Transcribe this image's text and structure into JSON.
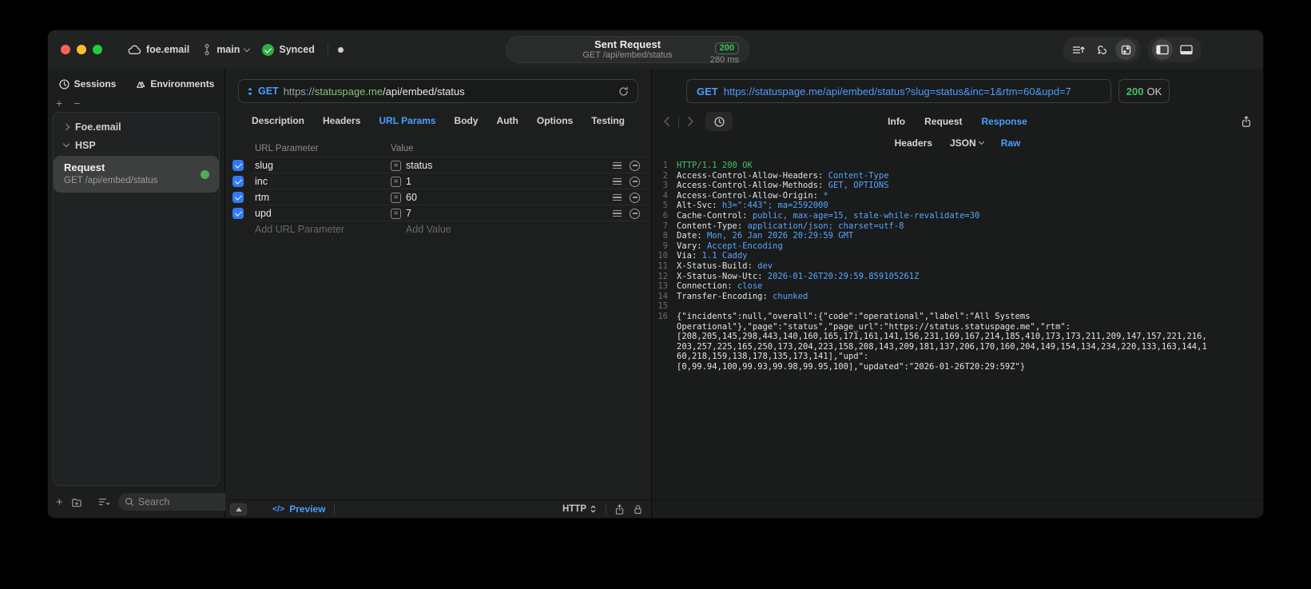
{
  "titlebar": {
    "project": "foe.email",
    "branch": "main",
    "sync_status": "Synced",
    "request_summary": {
      "title": "Sent Request",
      "subtitle": "GET /api/embed/status",
      "status_code": "200",
      "duration": "280 ms"
    }
  },
  "sidebar": {
    "tabs": [
      {
        "label": "Sessions"
      },
      {
        "label": "Environments"
      }
    ],
    "list_actions": {
      "add": "+",
      "remove": "−"
    },
    "tree": {
      "groups": [
        {
          "label": "Foe.email",
          "expanded": false
        },
        {
          "label": "HSP",
          "expanded": true
        }
      ],
      "selected_request": {
        "title": "Request",
        "subtitle": "GET /api/embed/status"
      }
    },
    "search": {
      "placeholder": "Search"
    }
  },
  "request_pane": {
    "method": "GET",
    "url": {
      "scheme": "https://",
      "host": "statuspage.me",
      "path": "/api/embed/status"
    },
    "tabs": [
      "Description",
      "Headers",
      "URL Params",
      "Body",
      "Auth",
      "Options",
      "Testing"
    ],
    "active_tab": "URL Params",
    "params": {
      "columns": [
        "URL Parameter",
        "Value"
      ],
      "rows": [
        {
          "name": "slug",
          "value": "status",
          "enabled": true
        },
        {
          "name": "inc",
          "value": "1",
          "enabled": true
        },
        {
          "name": "rtm",
          "value": "60",
          "enabled": true
        },
        {
          "name": "upd",
          "value": "7",
          "enabled": true
        }
      ],
      "add_name_placeholder": "Add URL Parameter",
      "add_value_placeholder": "Add Value"
    },
    "footer": {
      "preview_label": "Preview",
      "protocol_label": "HTTP"
    }
  },
  "response_pane": {
    "method": "GET",
    "url": "https://statuspage.me/api/embed/status?slug=status&inc=1&rtm=60&upd=7",
    "status_code": "200",
    "status_text": "OK",
    "tabs": [
      "Info",
      "Request",
      "Response"
    ],
    "active_tab": "Response",
    "subtabs": [
      "Headers",
      "JSON",
      "Raw"
    ],
    "active_subtab": "Raw",
    "status_line": "HTTP/1.1 200 OK",
    "headers": [
      {
        "name": "Access-Control-Allow-Headers",
        "value": "Content-Type"
      },
      {
        "name": "Access-Control-Allow-Methods",
        "value": "GET, OPTIONS"
      },
      {
        "name": "Access-Control-Allow-Origin",
        "value": "*"
      },
      {
        "name": "Alt-Svc",
        "value": "h3=\":443\"; ma=2592000"
      },
      {
        "name": "Cache-Control",
        "value": "public, max-age=15, stale-while-revalidate=30"
      },
      {
        "name": "Content-Type",
        "value": "application/json; charset=utf-8"
      },
      {
        "name": "Date",
        "value": "Mon, 26 Jan 2026 20:29:59 GMT"
      },
      {
        "name": "Vary",
        "value": "Accept-Encoding"
      },
      {
        "name": "Via",
        "value": "1.1 Caddy"
      },
      {
        "name": "X-Status-Build",
        "value": "dev"
      },
      {
        "name": "X-Status-Now-Utc",
        "value": "2026-01-26T20:29:59.859105261Z"
      },
      {
        "name": "Connection",
        "value": "close"
      },
      {
        "name": "Transfer-Encoding",
        "value": "chunked"
      }
    ],
    "body_lines": [
      "{\"incidents\":null,\"overall\":{\"code\":\"operational\",\"label\":\"All Systems",
      "Operational\"},\"page\":\"status\",\"page_url\":\"https://status.statuspage.me\",\"rtm\":",
      "[208,205,145,298,443,140,160,165,171,161,141,156,231,169,167,214,185,410,173,173,211,209,147,157,221,216,",
      "203,257,225,165,250,173,204,223,158,208,143,209,181,137,206,170,160,204,149,154,134,234,220,133,163,144,1",
      "60,218,159,138,178,135,173,141],\"upd\":",
      "[0,99.94,100,99.93,99.98,99.95,100],\"updated\":\"2026-01-26T20:29:59Z\"}"
    ]
  },
  "icons": {
    "equals": "=",
    "preview_code": "</>"
  },
  "colors": {
    "accent_blue": "#4B9EFF",
    "success_green": "#3FC35F",
    "checkbox_blue": "#3478F6",
    "url_host_green": "#84C177",
    "traffic_red": "#FF5F57",
    "traffic_yellow": "#FEBC2E",
    "traffic_green": "#28C840"
  }
}
